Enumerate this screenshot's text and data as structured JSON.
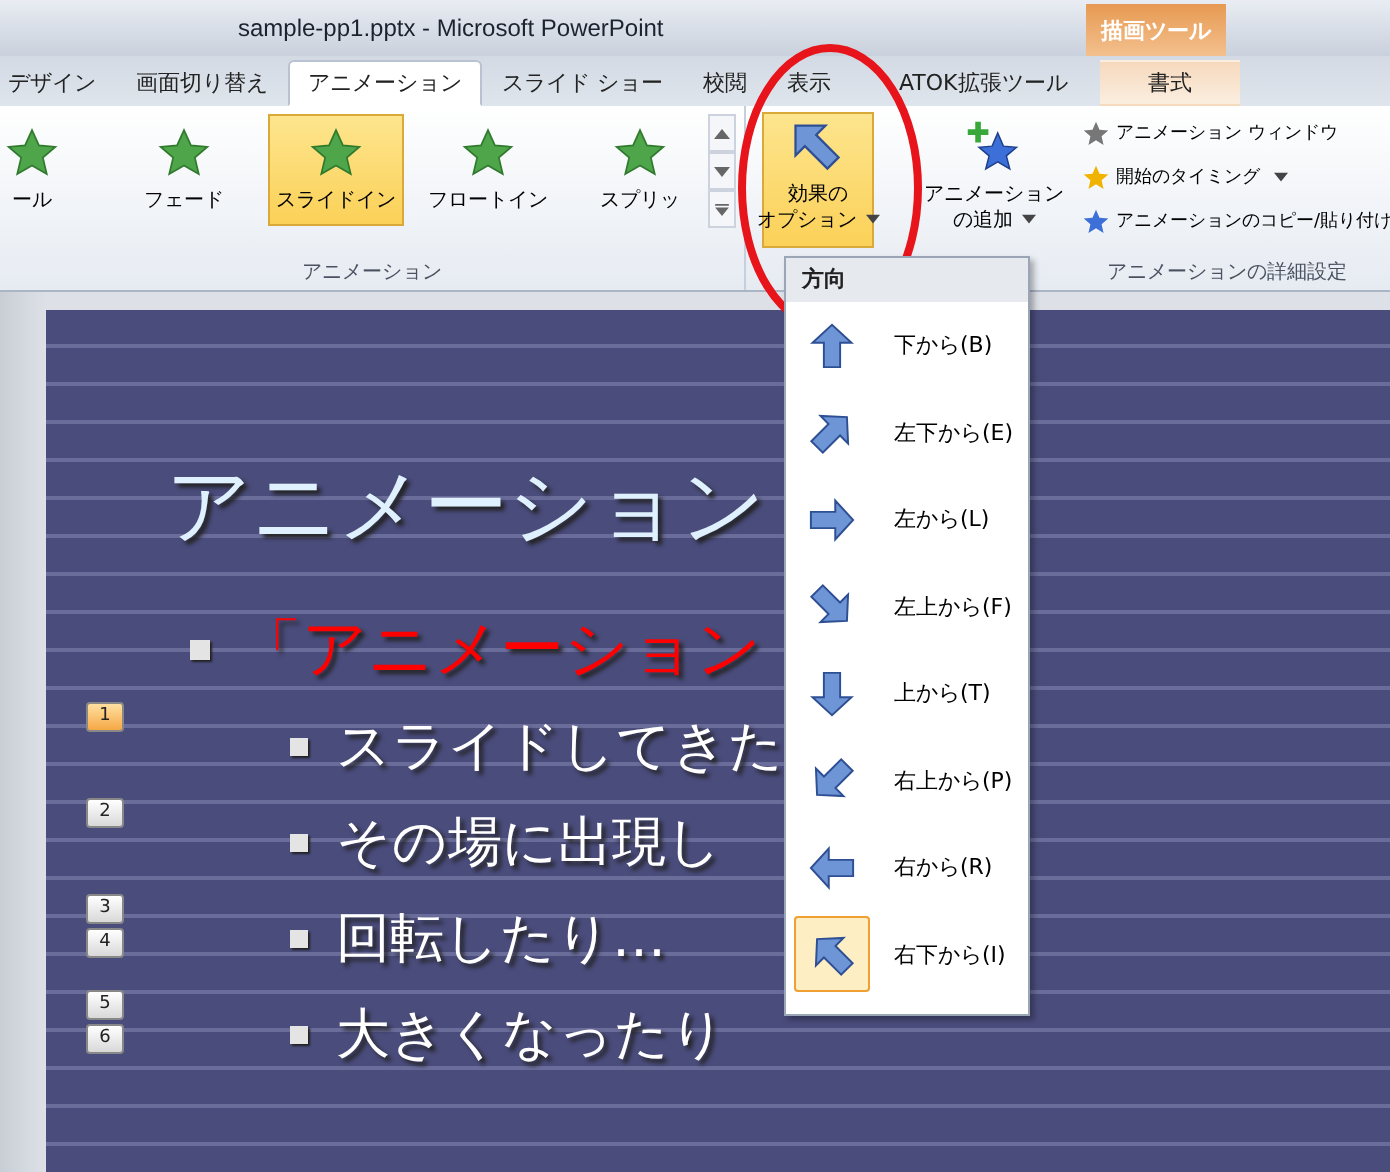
{
  "window": {
    "title": "sample-pp1.pptx - Microsoft PowerPoint"
  },
  "contextual_tab": {
    "label": "描画ツール"
  },
  "tabs": [
    {
      "label": "デザイン",
      "selected": false
    },
    {
      "label": "画面切り替え",
      "selected": false
    },
    {
      "label": "アニメーション",
      "selected": true
    },
    {
      "label": "スライド ショー",
      "selected": false
    },
    {
      "label": "校閲",
      "selected": false
    },
    {
      "label": "表示",
      "selected": false
    },
    {
      "label": "ATOK拡張ツール",
      "selected": false
    },
    {
      "label": "書式",
      "selected": false
    }
  ],
  "gallery": {
    "group_label": "アニメーション",
    "items": [
      {
        "label": "ール",
        "selected": false
      },
      {
        "label": "フェード",
        "selected": false
      },
      {
        "label": "スライドイン",
        "selected": true
      },
      {
        "label": "フロートイン",
        "selected": false
      },
      {
        "label": "スプリッ",
        "selected": false
      }
    ]
  },
  "effect_options": {
    "label_lines": [
      "効果の",
      "オプション"
    ],
    "expanded": true
  },
  "add_animation": {
    "label_lines": [
      "アニメーション",
      "の追加"
    ]
  },
  "advanced": {
    "group_label": "アニメーションの詳細設定",
    "items": [
      {
        "label": "アニメーション ウィンドウ",
        "dropdown": false
      },
      {
        "label": "開始のタイミング",
        "dropdown": true
      },
      {
        "label": "アニメーションのコピー/貼り付け",
        "dropdown": false
      }
    ]
  },
  "direction_menu": {
    "heading": "方向",
    "items": [
      {
        "label": "下から(B)",
        "selected": false
      },
      {
        "label": "左下から(E)",
        "selected": false
      },
      {
        "label": "左から(L)",
        "selected": false
      },
      {
        "label": "左上から(F)",
        "selected": false
      },
      {
        "label": "上から(T)",
        "selected": false
      },
      {
        "label": "右上から(P)",
        "selected": false
      },
      {
        "label": "右から(R)",
        "selected": false
      },
      {
        "label": "右下から(I)",
        "selected": true
      }
    ]
  },
  "slide": {
    "title": "アニメーション",
    "bullets": [
      {
        "kind": "heading",
        "text": "「アニメーション"
      },
      {
        "kind": "sub",
        "text": "スライドしてきた",
        "tags": [
          {
            "label": "1",
            "selected": true
          }
        ]
      },
      {
        "kind": "sub",
        "text": "その場に出現し",
        "tags": [
          {
            "label": "2",
            "selected": false
          }
        ]
      },
      {
        "kind": "sub",
        "text": "回転したり…",
        "tags": [
          {
            "label": "3",
            "selected": false
          },
          {
            "label": "4",
            "selected": false
          }
        ]
      },
      {
        "kind": "sub",
        "text": "大きくなったり",
        "tags": [
          {
            "label": "5",
            "selected": false
          },
          {
            "label": "6",
            "selected": false
          }
        ]
      }
    ]
  }
}
